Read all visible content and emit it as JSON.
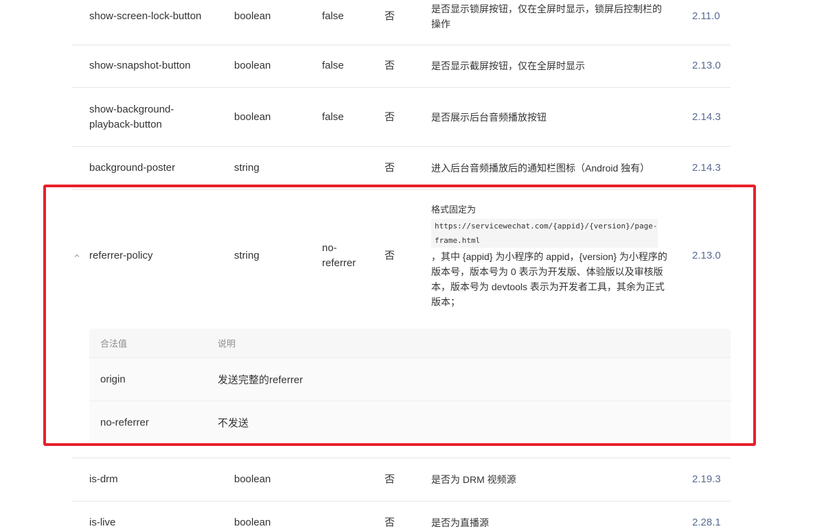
{
  "table": {
    "rows": [
      {
        "name": "show-screen-lock-button",
        "type": "boolean",
        "default": "false",
        "required": "否",
        "desc": "是否显示锁屏按钮，仅在全屏时显示，锁屏后控制栏的操作",
        "version": "2.11.0"
      },
      {
        "name": "show-snapshot-button",
        "type": "boolean",
        "default": "false",
        "required": "否",
        "desc": "是否显示截屏按钮，仅在全屏时显示",
        "version": "2.13.0"
      },
      {
        "name": "show-background-playback-button",
        "type": "boolean",
        "default": "false",
        "required": "否",
        "desc": "是否展示后台音频播放按钮",
        "version": "2.14.3"
      },
      {
        "name": "background-poster",
        "type": "string",
        "default": "",
        "required": "否",
        "desc": "进入后台音频播放后的通知栏图标（Android 独有）",
        "version": "2.14.3"
      },
      {
        "name": "referrer-policy",
        "type": "string",
        "default": "no-referrer",
        "required": "否",
        "desc_prefix": "格式固定为",
        "desc_code": "https://servicewechat.com/{appid}/{version}/page-frame.html",
        "desc_suffix": "，其中 {appid} 为小程序的 appid，{version} 为小程序的版本号，版本号为 0 表示为开发版、体验版以及审核版本，版本号为 devtools 表示为开发者工具，其余为正式版本；",
        "version": "2.13.0"
      },
      {
        "name": "is-drm",
        "type": "boolean",
        "default": "",
        "required": "否",
        "desc": "是否为 DRM 视频源",
        "version": "2.19.3"
      },
      {
        "name": "is-live",
        "type": "boolean",
        "default": "",
        "required": "否",
        "desc": "是否为直播源",
        "version": "2.28.1"
      }
    ]
  },
  "subtable": {
    "headers": [
      "合法值",
      "说明"
    ],
    "rows": [
      {
        "value": "origin",
        "desc": "发送完整的referrer"
      },
      {
        "value": "no-referrer",
        "desc": "不发送"
      }
    ]
  },
  "icons": {
    "expand": "chevron-up-icon"
  },
  "colors": {
    "version_link": "#576b95",
    "highlight": "#e8202a"
  }
}
